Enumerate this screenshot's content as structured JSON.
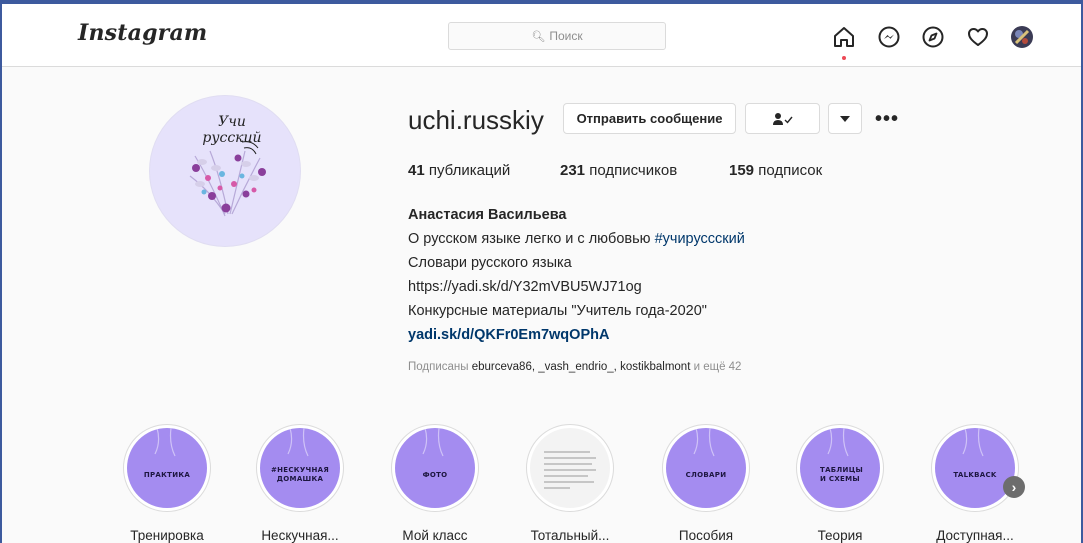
{
  "app": {
    "logo_text": "Instagram"
  },
  "search": {
    "placeholder": "Поиск"
  },
  "nav": {
    "icons": [
      "home-icon",
      "messenger-icon",
      "explore-icon",
      "activity-heart-icon",
      "profile-avatar-icon"
    ],
    "notification_color": "#ed4956"
  },
  "profile": {
    "avatar_text": "Учи русский",
    "username": "uchi.russkiy",
    "message_button": "Отправить сообщение",
    "follow_icon": "person-check-icon",
    "dropdown_icon": "caret-down-icon",
    "options_icon": "more-dots-icon",
    "stats": {
      "posts_count": "41",
      "posts_label": "публикаций",
      "followers_count": "231",
      "followers_label": "подписчиков",
      "following_count": "159",
      "following_label": "подписок"
    },
    "bio": {
      "full_name": "Анастасия Васильева",
      "line1_text": "О русском языке легко и с любовью ",
      "line1_hashtag": "#учирусccкий",
      "line2": "Словари русского языка",
      "line3": "https://yadi.sk/d/Y32mVBU5WJ71og",
      "line4": "Конкурсные материалы \"Учитель года-2020\"",
      "link": "yadi.sk/d/QKFr0Em7wqOPhA"
    },
    "followed_by": {
      "prefix": "Подписаны",
      "names": "eburceva86, _vash_endrio_, kostikbalmont",
      "suffix": "и ещё 42"
    }
  },
  "highlights": [
    {
      "label": "Тренировка",
      "cover_text": "ПРАКТИКА"
    },
    {
      "label": "Нескучная...",
      "cover_text": "#НЕСКУЧНАЯ ДОМАШКА"
    },
    {
      "label": "Мой класс",
      "cover_text": "ФОТО"
    },
    {
      "label": "Тотальный...",
      "cover_text": ""
    },
    {
      "label": "Пособия",
      "cover_text": "СЛОВАРИ"
    },
    {
      "label": "Теория",
      "cover_text": "ТАБЛИЦЫ И СХЕМЫ"
    },
    {
      "label": "Доступная...",
      "cover_text": "TALKBACK"
    }
  ],
  "highlights_next_icon": "chevron-right-icon",
  "colors": {
    "accent_purple": "#a48cf0",
    "link_blue": "#00376b",
    "frame_blue": "#3d5a9e"
  }
}
